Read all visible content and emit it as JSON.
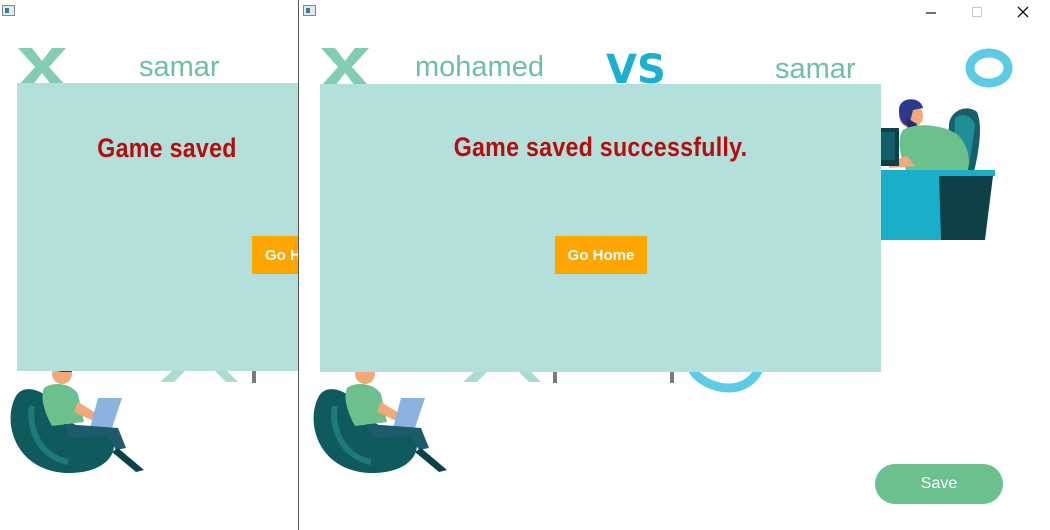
{
  "back_window": {
    "player_right_name": "samar",
    "dialog": {
      "message": "Game saved",
      "button_label": "Go H"
    }
  },
  "front_window": {
    "player_one_name": "mohamed",
    "vs_label": "VS",
    "player_two_name": "samar",
    "dialog": {
      "message": "Game saved successfully.",
      "button_label": "Go Home"
    },
    "save_label": "Save"
  },
  "icons": {
    "x_mark": "x-mark-icon",
    "o_mark": "o-mark-icon",
    "app": "app-icon",
    "minimize": "minimize-icon",
    "maximize": "maximize-icon",
    "close": "close-icon"
  },
  "colors": {
    "dialog_bg": "#b4e0dc",
    "message": "#b30d0d",
    "go_home_bg": "#ffa500",
    "save_bg": "#6cc08e",
    "player_name": "#6ec1a0",
    "vs": "#1bafd0"
  }
}
